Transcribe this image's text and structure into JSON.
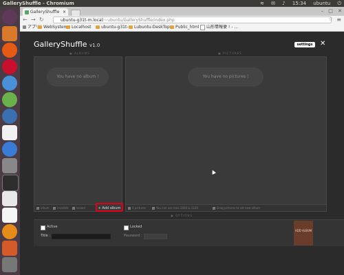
{
  "os": {
    "window_title": "GalleryShuffle - Chromium",
    "clock": "15:34",
    "user": "ubuntu"
  },
  "browser": {
    "tab_title": "GalleryShuffle",
    "url_host": "ubuntu-g31t-m.local",
    "url_path": "/~ubuntu/GalleryShuffle/index.php",
    "bookmarks": [
      "アプリ",
      "WebSystem",
      "Localhost",
      "ubuntu-g31t-m",
      "Lubuntu-DeskTop",
      "Public_html",
      "山形情報便 ! - ..."
    ]
  },
  "app": {
    "title": "GalleryShuffle",
    "version": "v1.0",
    "settings_label": "settings",
    "close_label": "✕",
    "albums_label": "ALBUMS",
    "pictures_label": "PICTURES",
    "options_label": "OPTIONS",
    "no_album": "You have no album !",
    "no_pictures": "You have no pictures !",
    "album_footer": [
      "album",
      "invisible",
      "locked"
    ],
    "add_album": "Add album",
    "pictures_footer": [
      "0 pictures",
      "You can use max 2000 & 3100",
      "Drag pictures to set new album"
    ],
    "options": {
      "active_label": "Active",
      "locked_label": "Locked",
      "title_label": "Title :",
      "password_label": "Password :",
      "add_album_label": "ADD ALBUM"
    }
  }
}
